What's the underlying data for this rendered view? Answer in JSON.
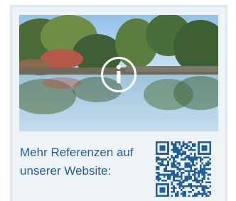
{
  "card": {
    "caption": "Mehr Referenzen auf unserer Website:",
    "photo_icon": "info-icon",
    "qr_icon": "qr-code-icon"
  },
  "colors": {
    "caption_text": "#1f5f9a",
    "card_background": "#eef3f8",
    "card_border": "#dfe6ee",
    "qr_dark": "#1f5f9a"
  }
}
